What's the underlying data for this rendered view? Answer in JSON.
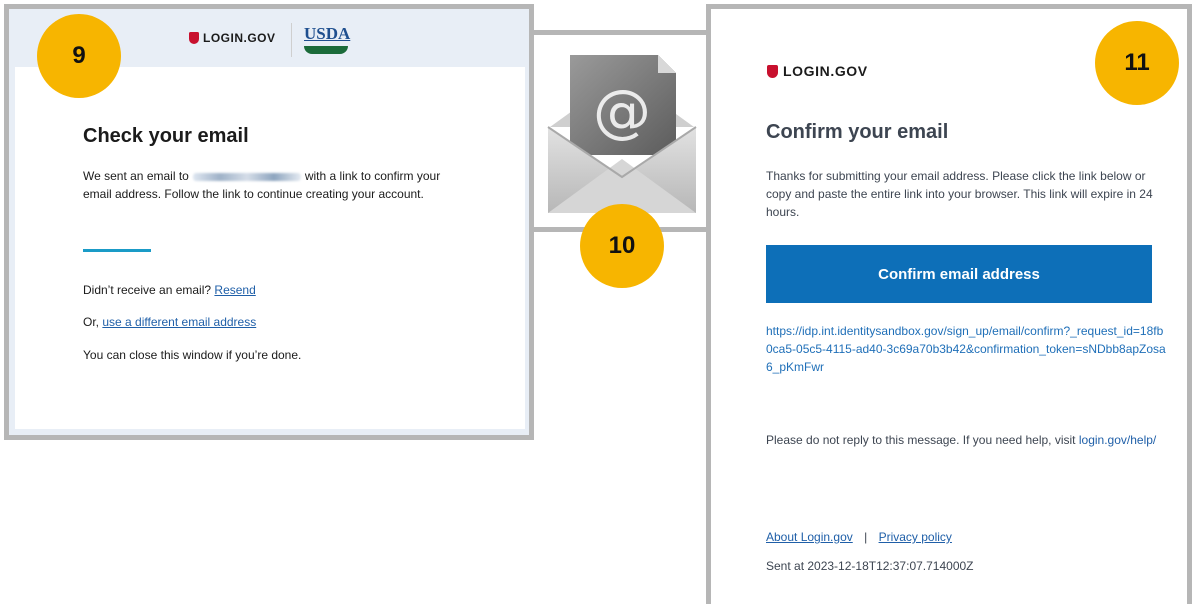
{
  "badges": {
    "step9": "9",
    "step10": "10",
    "step11": "11"
  },
  "panel9": {
    "logo_text": "LOGIN.GOV",
    "partner_logo_text": "USDA",
    "title": "Check your email",
    "body_before": "We sent an email to",
    "body_after": "with a link to confirm your email address. Follow the link to continue creating your account.",
    "didnt_receive_text": "Didn’t receive an email?",
    "resend_link": "Resend",
    "or_text": "Or,",
    "different_email_link": "use a different email address",
    "close_text": "You can close this window if you’re done."
  },
  "panel11": {
    "logo_text": "LOGIN.GOV",
    "title": "Confirm your email",
    "body": "Thanks for submitting your email address. Please click the link below or copy and paste the entire link into your browser. This link will expire in 24 hours.",
    "button_label": "Confirm email address",
    "confirm_url": "https://idp.int.identitysandbox.gov/sign_up/email/confirm?_request_id=18fb0ca5-05c5-4115-ad40-3c69a70b3b42&confirmation_token=sNDbb8apZosa6_pKmFwr",
    "noreply_text": "Please do not reply to this message. If you need help, visit",
    "help_link": "login.gov/help/",
    "about_link": "About Login.gov",
    "footer_separator": "|",
    "privacy_link": "Privacy policy",
    "sent_at": "Sent at 2023-12-18T12:37:07.714000Z"
  },
  "colors": {
    "badge": "#f7b500",
    "panel_border": "#b6b6b6",
    "primary_button": "#0d6fb8",
    "link": "#1f6fb8",
    "brand_red": "#c8102e"
  },
  "icons": {
    "envelope": "email-envelope-at-icon",
    "shield": "login-gov-shield-icon"
  }
}
